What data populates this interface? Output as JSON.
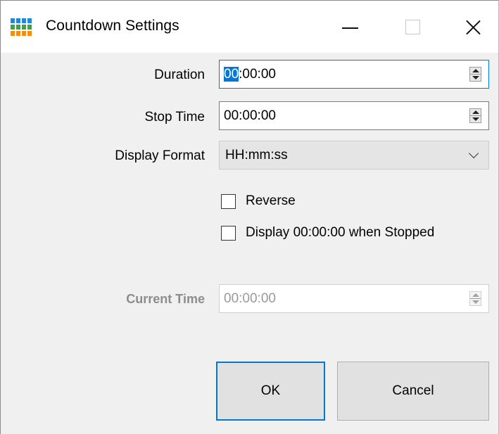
{
  "window": {
    "title": "Countdown Settings",
    "icon": "app-grid-icon",
    "accent_color": "#0078d7"
  },
  "fields": {
    "duration": {
      "label": "Duration",
      "value_selected": "00",
      "value_rest": ":00:00"
    },
    "stop_time": {
      "label": "Stop Time",
      "value": "00:00:00"
    },
    "display_format": {
      "label": "Display Format",
      "value": "HH:mm:ss"
    },
    "current_time": {
      "label": "Current Time",
      "value": "00:00:00",
      "disabled": true
    }
  },
  "checkboxes": {
    "reverse": {
      "label": "Reverse",
      "checked": false
    },
    "display_zero": {
      "label": "Display 00:00:00 when Stopped",
      "checked": false
    }
  },
  "buttons": {
    "ok": "OK",
    "cancel": "Cancel"
  }
}
